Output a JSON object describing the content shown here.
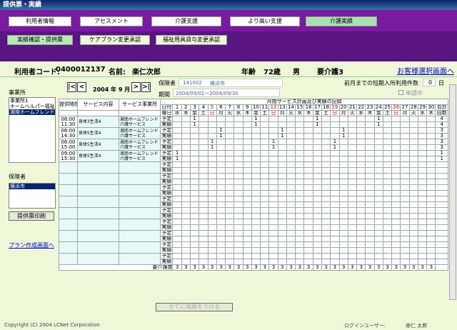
{
  "title": "提供票・実績",
  "nav": [
    "利用者情報",
    "アセスメント",
    "介護支援",
    "より高い支援",
    "介護実績"
  ],
  "subnav": [
    "実績確認・提供票",
    "ケアプラン変更承認",
    "福祉用具貸与変更承認"
  ],
  "patient": {
    "code_label": "利用者コード:",
    "code": "0400012137",
    "name_label": "名前:",
    "name": "楽仁次郎",
    "age_label": "年齢",
    "age": "72歳",
    "sex": "男",
    "care": "要介護3",
    "link": "お客様選択画面へ"
  },
  "left": {
    "office_label": "事業所",
    "offices": [
      "事業所1",
      "ホームヘルパー福祉",
      "湘南ホームフレンド"
    ],
    "insurer_label": "保険者",
    "insurers": [
      "横浜市"
    ],
    "print_btn": "提供票印刷",
    "plan_link": "プラン作成画面へ"
  },
  "period": {
    "month": "2004 年 9 月",
    "insurer_label": "保険者",
    "insurer_no": "141002",
    "insurer_name": "横浜市",
    "period_label": "期間",
    "period": "2004/09/01～2004/09/30",
    "shortstay_label": "前月までの短期入所利用件数",
    "shortstay": "0",
    "shortstay_unit": "日",
    "apply": "申請中"
  },
  "grid": {
    "head_time": "提供時間帯",
    "head_svc": "サービス内容",
    "head_office": "サービス事業所",
    "head_plan": "月間サービス計画及び実績の記録",
    "date_label": "日付",
    "dow_label": "曜日",
    "total": "合計",
    "count": "回数",
    "plan": "予定",
    "actual": "実績",
    "care_label": "要介護度",
    "days": [
      "1",
      "2",
      "3",
      "4",
      "5",
      "6",
      "7",
      "8",
      "9",
      "10",
      "11",
      "12",
      "13",
      "14",
      "15",
      "16",
      "17",
      "18",
      "19",
      "20",
      "21",
      "22",
      "23",
      "24",
      "25",
      "26",
      "27",
      "28",
      "29",
      "30"
    ],
    "dows": [
      "水",
      "木",
      "金",
      "土",
      "日",
      "月",
      "火",
      "水",
      "木",
      "金",
      "土",
      "日",
      "月",
      "火",
      "水",
      "木",
      "金",
      "土",
      "日",
      "月",
      "火",
      "水",
      "木",
      "金",
      "土",
      "日",
      "月",
      "火",
      "水",
      "木"
    ],
    "rows": [
      {
        "time1": "08:00",
        "time2": "11:30",
        "svc": "身体3生活4",
        "office": "湘南ホームフレンド介護サービス",
        "plan": [
          3,
          10,
          17,
          24
        ],
        "actual": [
          3,
          10,
          17,
          24
        ],
        "total_p": "4",
        "total_a": "4"
      },
      {
        "time1": "08:00",
        "time2": "14:30",
        "svc": "身体5生活4",
        "office": "湘南ホームフレンド介護サービス",
        "plan": [
          6,
          13,
          20
        ],
        "actual": [
          6,
          13,
          20
        ],
        "total_p": "3",
        "total_a": "3"
      },
      {
        "time1": "08:00",
        "time2": "15:00",
        "svc": "身体5生活4",
        "office": "湘南ホームフレンド介護サービス",
        "plan": [
          5,
          12,
          19
        ],
        "actual": [
          5,
          12,
          19
        ],
        "total_p": "3",
        "total_a": "3"
      },
      {
        "time1": "09:00",
        "time2": "15:30",
        "svc": "身体5生活4",
        "office": "湘南ホームフレンド介護サービス",
        "plan": [
          1
        ],
        "actual": [
          1
        ],
        "total_p": "1",
        "total_a": "1"
      }
    ],
    "care_value": "3",
    "confirm_btn": "全てに実績をうける"
  },
  "footer": {
    "copy": "Copyright (C) 2004 LCNet Corporation",
    "user_label": "ログインユーザー:",
    "user": "楽仁 太郎"
  },
  "colors": {
    "nav": "#7a1aa0",
    "nav2": "#5a1680",
    "bg": "#eef8d8",
    "holiday": "#dd0000"
  }
}
